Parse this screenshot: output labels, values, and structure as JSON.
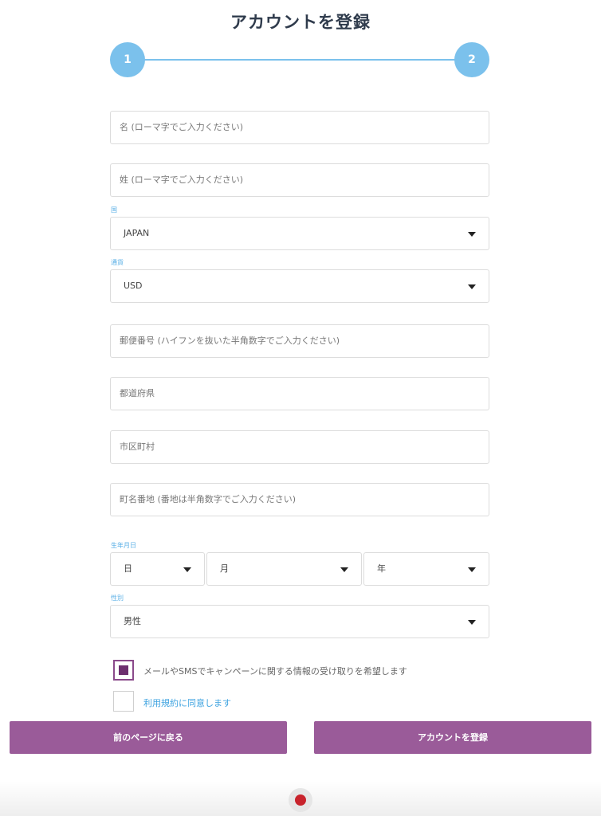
{
  "title": "アカウントを登録",
  "stepper": {
    "step1": "1",
    "step2": "2"
  },
  "form": {
    "first_name_placeholder": "名 (ローマ字でご入力ください)",
    "last_name_placeholder": "姓 (ローマ字でご入力ください)",
    "country_label": "国",
    "country_value": "JAPAN",
    "currency_label": "通貨",
    "currency_value": "USD",
    "postal_placeholder": "郵便番号 (ハイフンを抜いた半角数字でご入力ください)",
    "prefecture_placeholder": "都道府県",
    "city_placeholder": "市区町村",
    "street_placeholder": "町名番地 (番地は半角数字でご入力ください)",
    "birthdate_label": "生年月日",
    "day_value": "日",
    "month_value": "月",
    "year_value": "年",
    "gender_label": "性別",
    "gender_value": "男性"
  },
  "consents": {
    "marketing_text": "メールやSMSでキャンペーンに関する情報の受け取りを希望します",
    "marketing_checked": true,
    "terms_text": "利用規約に同意します",
    "terms_checked": false
  },
  "buttons": {
    "back": "前のページに戻る",
    "register": "アカウントを登録"
  },
  "colors": {
    "accent_blue": "#7bc1ec",
    "button_purple": "#9a5b99",
    "record_red": "#c8232c"
  }
}
